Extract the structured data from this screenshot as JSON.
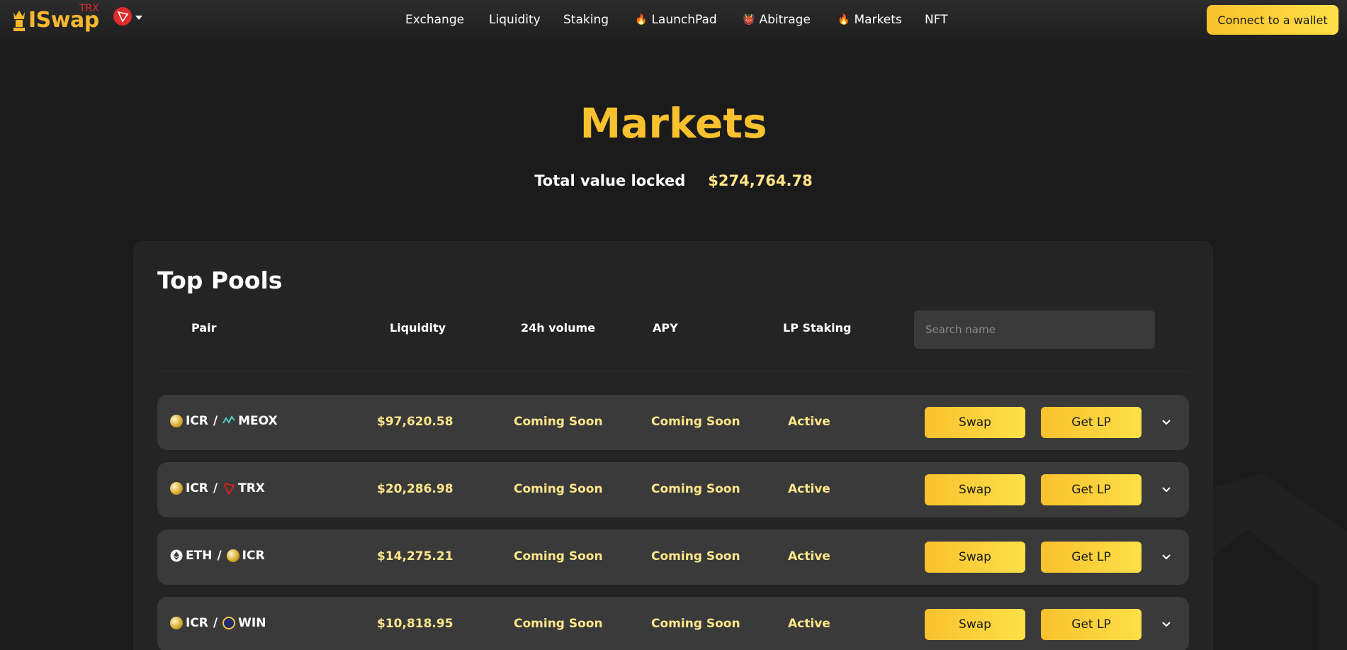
{
  "header": {
    "logo_text": "ISwap",
    "logo_sup": "TRX",
    "nav": [
      {
        "label": "Exchange",
        "emoji": ""
      },
      {
        "label": "Liquidity",
        "emoji": ""
      },
      {
        "label": "Staking",
        "emoji": ""
      },
      {
        "label": "LaunchPad",
        "emoji": "🔥"
      },
      {
        "label": "Abitrage",
        "emoji": "👹"
      },
      {
        "label": "Markets",
        "emoji": "🔥"
      },
      {
        "label": "NFT",
        "emoji": ""
      }
    ],
    "connect_label": "Connect to a wallet"
  },
  "hero": {
    "title": "Markets",
    "tvl_label": "Total value locked",
    "tvl_value": "$274,764.78"
  },
  "pools": {
    "title": "Top Pools",
    "columns": {
      "pair": "Pair",
      "liquidity": "Liquidity",
      "volume": "24h volume",
      "apy": "APY",
      "lp_staking": "LP Staking"
    },
    "search_placeholder": "Search name",
    "rows": [
      {
        "token_a": "ICR",
        "icon_a": "icr-coin-icon",
        "token_b": "MEOX",
        "icon_b": "meox-icon",
        "sep": "/",
        "liquidity": "$97,620.58",
        "volume": "Coming Soon",
        "apy": "Coming Soon",
        "lp_staking": "Active",
        "swap": "Swap",
        "get_lp": "Get LP"
      },
      {
        "token_a": "ICR",
        "icon_a": "icr-coin-icon",
        "token_b": "TRX",
        "icon_b": "trx-icon",
        "sep": "/",
        "liquidity": "$20,286.98",
        "volume": "Coming Soon",
        "apy": "Coming Soon",
        "lp_staking": "Active",
        "swap": "Swap",
        "get_lp": "Get LP"
      },
      {
        "token_a": "ETH",
        "icon_a": "eth-icon",
        "token_b": "ICR",
        "icon_b": "icr-coin-icon",
        "sep": "/",
        "liquidity": "$14,275.21",
        "volume": "Coming Soon",
        "apy": "Coming Soon",
        "lp_staking": "Active",
        "swap": "Swap",
        "get_lp": "Get LP"
      },
      {
        "token_a": "ICR",
        "icon_a": "icr-coin-icon",
        "token_b": "WIN",
        "icon_b": "win-icon",
        "sep": "/",
        "liquidity": "$10,818.95",
        "volume": "Coming Soon",
        "apy": "Coming Soon",
        "lp_staking": "Active",
        "swap": "Swap",
        "get_lp": "Get LP"
      }
    ]
  },
  "colors": {
    "accent": "#f9c12e",
    "accent_light": "#fde68a",
    "background": "#1b1b1b",
    "panel": "#242424",
    "row": "#3a3a3a"
  }
}
